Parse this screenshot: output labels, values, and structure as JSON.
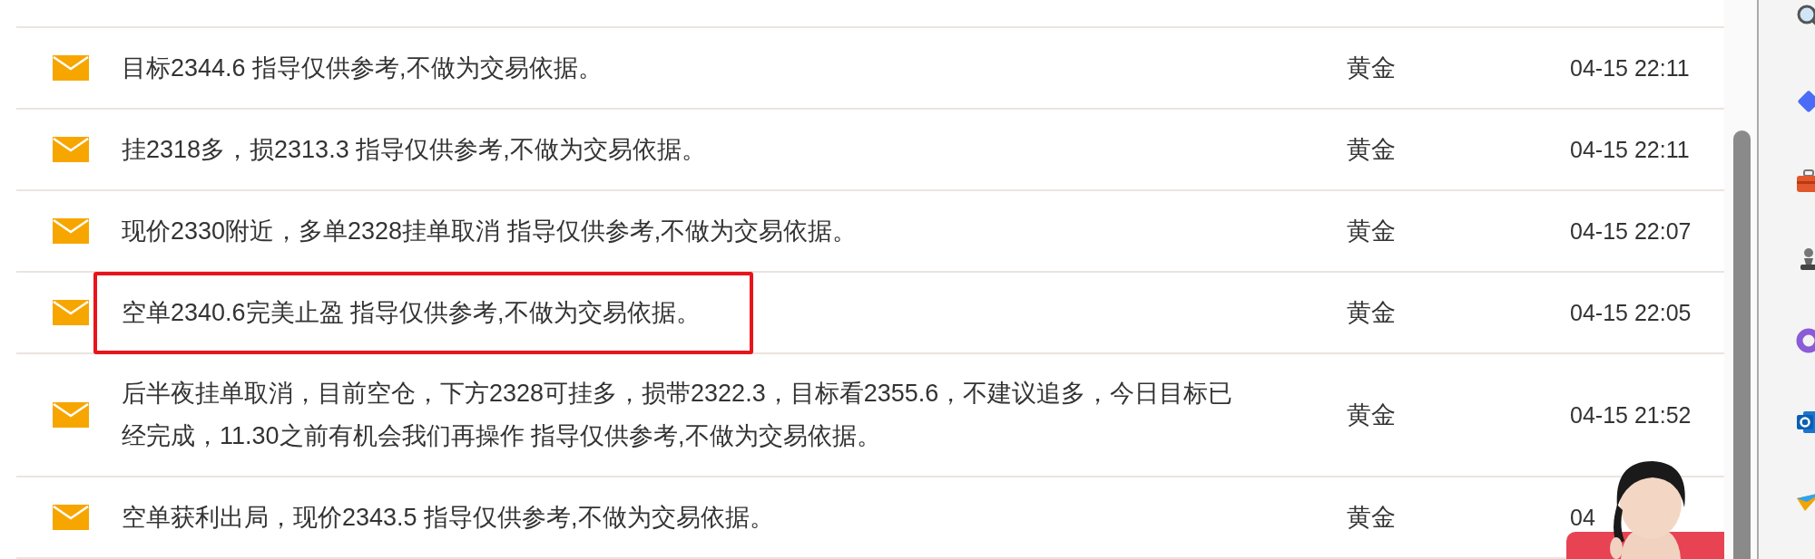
{
  "rows": [
    {
      "title": "目标2344.6 指导仅供参考,不做为交易依据。",
      "variety": "黄金",
      "time": "04-15 22:11",
      "highlighted": false
    },
    {
      "title": "挂2318多，损2313.3 指导仅供参考,不做为交易依据。",
      "variety": "黄金",
      "time": "04-15 22:11",
      "highlighted": false
    },
    {
      "title": "现价2330附近，多单2328挂单取消 指导仅供参考,不做为交易依据。",
      "variety": "黄金",
      "time": "04-15 22:07",
      "highlighted": false
    },
    {
      "title": "空单2340.6完美止盈 指导仅供参考,不做为交易依据。",
      "variety": "黄金",
      "time": "04-15 22:05",
      "highlighted": true
    },
    {
      "title": "后半夜挂单取消，目前空仓，下方2328可挂多，损带2322.3，目标看2355.6，不建议追多，今日目标已经完成，11.30之前有机会我们再操作 指导仅供参考,不做为交易依据。",
      "variety": "黄金",
      "time": "04-15 21:52",
      "highlighted": false
    },
    {
      "title": "空单获利出局，现价2343.5 指导仅供参考,不做为交易依据。",
      "variety": "黄金",
      "time": "04",
      "highlighted": false
    }
  ]
}
